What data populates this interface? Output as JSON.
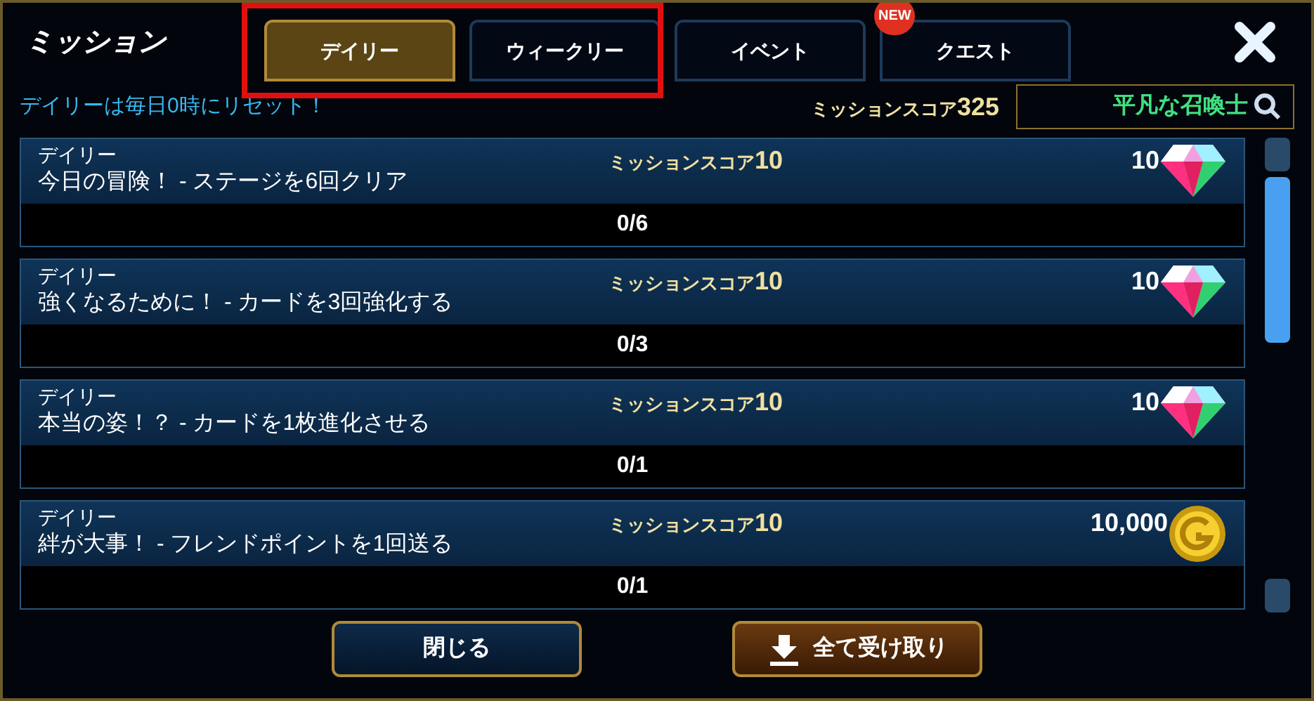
{
  "window": {
    "title": "ミッション"
  },
  "tabs": [
    {
      "label": "デイリー",
      "selected": true
    },
    {
      "label": "ウィークリー",
      "selected": false
    },
    {
      "label": "イベント",
      "selected": false
    },
    {
      "label": "クエスト",
      "selected": false,
      "badge": "NEW"
    }
  ],
  "reset_note": "デイリーは毎日0時にリセット！",
  "mission_score": {
    "label": "ミッションスコア",
    "value": "325"
  },
  "search": {
    "value": "平凡な召喚士"
  },
  "missions": [
    {
      "category": "デイリー",
      "title": "今日の冒険！ - ステージを6回クリア",
      "score_label": "ミッションスコア",
      "score": "10",
      "reward": "10",
      "kind": "gem",
      "progress": "0/6"
    },
    {
      "category": "デイリー",
      "title": "強くなるために！ - カードを3回強化する",
      "score_label": "ミッションスコア",
      "score": "10",
      "reward": "10",
      "kind": "gem",
      "progress": "0/3"
    },
    {
      "category": "デイリー",
      "title": "本当の姿！？ - カードを1枚進化させる",
      "score_label": "ミッションスコア",
      "score": "10",
      "reward": "10",
      "kind": "gem",
      "progress": "0/1"
    },
    {
      "category": "デイリー",
      "title": "絆が大事！ - フレンドポイントを1回送る",
      "score_label": "ミッションスコア",
      "score": "10",
      "reward": "10,000",
      "kind": "coin",
      "progress": "0/1"
    }
  ],
  "buttons": {
    "close": "閉じる",
    "receive_all": "全て受け取り"
  }
}
